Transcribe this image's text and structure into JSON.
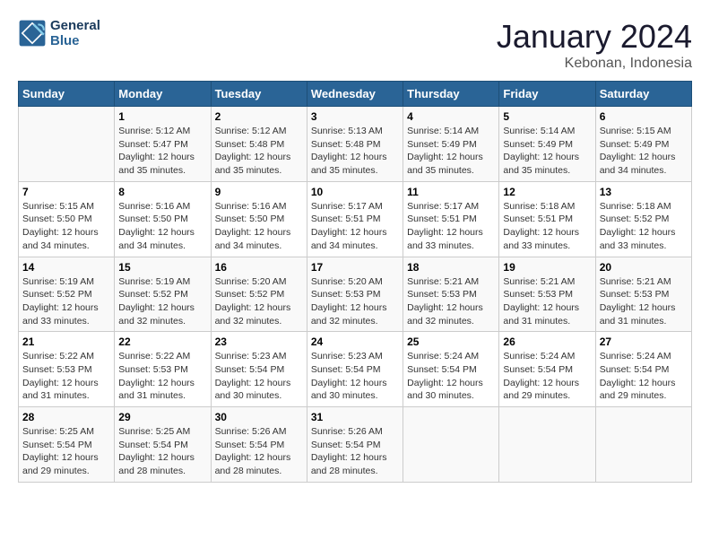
{
  "header": {
    "logo_line1": "General",
    "logo_line2": "Blue",
    "main_title": "January 2024",
    "subtitle": "Kebonan, Indonesia"
  },
  "days_of_week": [
    "Sunday",
    "Monday",
    "Tuesday",
    "Wednesday",
    "Thursday",
    "Friday",
    "Saturday"
  ],
  "weeks": [
    [
      {
        "day": "",
        "info": ""
      },
      {
        "day": "1",
        "info": "Sunrise: 5:12 AM\nSunset: 5:47 PM\nDaylight: 12 hours\nand 35 minutes."
      },
      {
        "day": "2",
        "info": "Sunrise: 5:12 AM\nSunset: 5:48 PM\nDaylight: 12 hours\nand 35 minutes."
      },
      {
        "day": "3",
        "info": "Sunrise: 5:13 AM\nSunset: 5:48 PM\nDaylight: 12 hours\nand 35 minutes."
      },
      {
        "day": "4",
        "info": "Sunrise: 5:14 AM\nSunset: 5:49 PM\nDaylight: 12 hours\nand 35 minutes."
      },
      {
        "day": "5",
        "info": "Sunrise: 5:14 AM\nSunset: 5:49 PM\nDaylight: 12 hours\nand 35 minutes."
      },
      {
        "day": "6",
        "info": "Sunrise: 5:15 AM\nSunset: 5:49 PM\nDaylight: 12 hours\nand 34 minutes."
      }
    ],
    [
      {
        "day": "7",
        "info": "Sunrise: 5:15 AM\nSunset: 5:50 PM\nDaylight: 12 hours\nand 34 minutes."
      },
      {
        "day": "8",
        "info": "Sunrise: 5:16 AM\nSunset: 5:50 PM\nDaylight: 12 hours\nand 34 minutes."
      },
      {
        "day": "9",
        "info": "Sunrise: 5:16 AM\nSunset: 5:50 PM\nDaylight: 12 hours\nand 34 minutes."
      },
      {
        "day": "10",
        "info": "Sunrise: 5:17 AM\nSunset: 5:51 PM\nDaylight: 12 hours\nand 34 minutes."
      },
      {
        "day": "11",
        "info": "Sunrise: 5:17 AM\nSunset: 5:51 PM\nDaylight: 12 hours\nand 33 minutes."
      },
      {
        "day": "12",
        "info": "Sunrise: 5:18 AM\nSunset: 5:51 PM\nDaylight: 12 hours\nand 33 minutes."
      },
      {
        "day": "13",
        "info": "Sunrise: 5:18 AM\nSunset: 5:52 PM\nDaylight: 12 hours\nand 33 minutes."
      }
    ],
    [
      {
        "day": "14",
        "info": "Sunrise: 5:19 AM\nSunset: 5:52 PM\nDaylight: 12 hours\nand 33 minutes."
      },
      {
        "day": "15",
        "info": "Sunrise: 5:19 AM\nSunset: 5:52 PM\nDaylight: 12 hours\nand 32 minutes."
      },
      {
        "day": "16",
        "info": "Sunrise: 5:20 AM\nSunset: 5:52 PM\nDaylight: 12 hours\nand 32 minutes."
      },
      {
        "day": "17",
        "info": "Sunrise: 5:20 AM\nSunset: 5:53 PM\nDaylight: 12 hours\nand 32 minutes."
      },
      {
        "day": "18",
        "info": "Sunrise: 5:21 AM\nSunset: 5:53 PM\nDaylight: 12 hours\nand 32 minutes."
      },
      {
        "day": "19",
        "info": "Sunrise: 5:21 AM\nSunset: 5:53 PM\nDaylight: 12 hours\nand 31 minutes."
      },
      {
        "day": "20",
        "info": "Sunrise: 5:21 AM\nSunset: 5:53 PM\nDaylight: 12 hours\nand 31 minutes."
      }
    ],
    [
      {
        "day": "21",
        "info": "Sunrise: 5:22 AM\nSunset: 5:53 PM\nDaylight: 12 hours\nand 31 minutes."
      },
      {
        "day": "22",
        "info": "Sunrise: 5:22 AM\nSunset: 5:53 PM\nDaylight: 12 hours\nand 31 minutes."
      },
      {
        "day": "23",
        "info": "Sunrise: 5:23 AM\nSunset: 5:54 PM\nDaylight: 12 hours\nand 30 minutes."
      },
      {
        "day": "24",
        "info": "Sunrise: 5:23 AM\nSunset: 5:54 PM\nDaylight: 12 hours\nand 30 minutes."
      },
      {
        "day": "25",
        "info": "Sunrise: 5:24 AM\nSunset: 5:54 PM\nDaylight: 12 hours\nand 30 minutes."
      },
      {
        "day": "26",
        "info": "Sunrise: 5:24 AM\nSunset: 5:54 PM\nDaylight: 12 hours\nand 29 minutes."
      },
      {
        "day": "27",
        "info": "Sunrise: 5:24 AM\nSunset: 5:54 PM\nDaylight: 12 hours\nand 29 minutes."
      }
    ],
    [
      {
        "day": "28",
        "info": "Sunrise: 5:25 AM\nSunset: 5:54 PM\nDaylight: 12 hours\nand 29 minutes."
      },
      {
        "day": "29",
        "info": "Sunrise: 5:25 AM\nSunset: 5:54 PM\nDaylight: 12 hours\nand 28 minutes."
      },
      {
        "day": "30",
        "info": "Sunrise: 5:26 AM\nSunset: 5:54 PM\nDaylight: 12 hours\nand 28 minutes."
      },
      {
        "day": "31",
        "info": "Sunrise: 5:26 AM\nSunset: 5:54 PM\nDaylight: 12 hours\nand 28 minutes."
      },
      {
        "day": "",
        "info": ""
      },
      {
        "day": "",
        "info": ""
      },
      {
        "day": "",
        "info": ""
      }
    ]
  ]
}
